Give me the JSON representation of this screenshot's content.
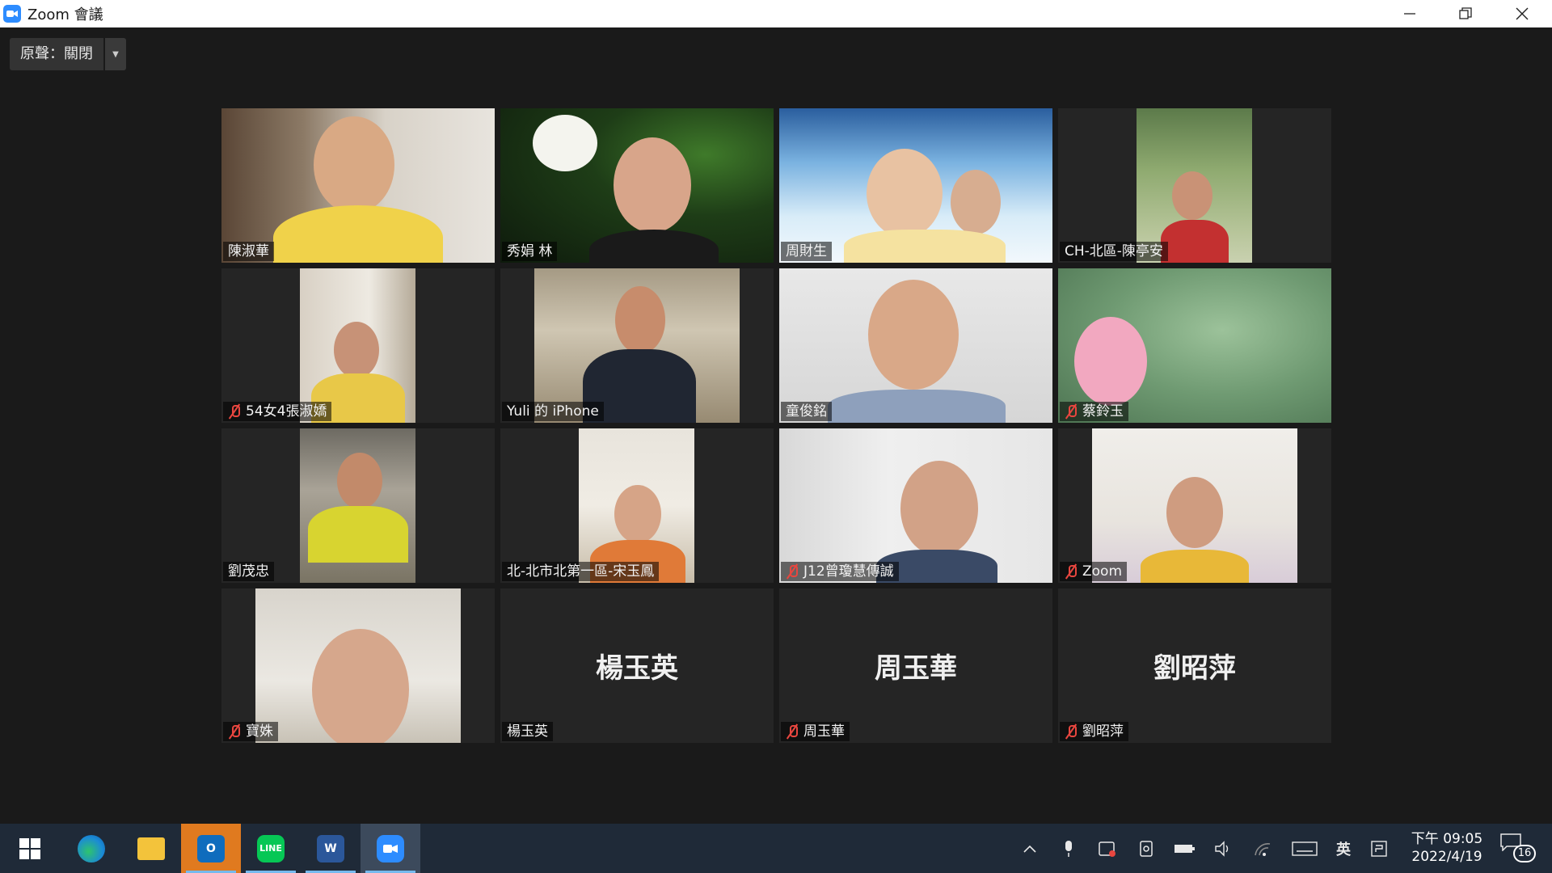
{
  "window": {
    "title": "Zoom 會議"
  },
  "toolbar": {
    "original_sound": "原聲：關閉"
  },
  "participants": [
    {
      "name": "陳淑華",
      "muted": false
    },
    {
      "name": "秀娟 林",
      "muted": false,
      "active_speaker": true
    },
    {
      "name": "周財生",
      "muted": false
    },
    {
      "name": "CH-北區-陳亭安",
      "muted": false
    },
    {
      "name": "54女4張淑嬌",
      "muted": true
    },
    {
      "name": "Yuli 的 iPhone",
      "muted": false
    },
    {
      "name": "童俊銘",
      "muted": false
    },
    {
      "name": "蔡鈴玉",
      "muted": true
    },
    {
      "name": "劉茂忠",
      "muted": false
    },
    {
      "name": "北-北市北第一區-宋玉鳳",
      "muted": false
    },
    {
      "name": "J12曾瓊慧傳誠",
      "muted": true
    },
    {
      "name": "Zoom",
      "muted": true
    },
    {
      "name": "寶姝",
      "muted": true
    },
    {
      "name": "楊玉英",
      "muted": false,
      "video_off": true
    },
    {
      "name": "周玉華",
      "muted": true,
      "video_off": true
    },
    {
      "name": "劉昭萍",
      "muted": true,
      "video_off": true
    }
  ],
  "taskbar": {
    "apps": [
      "start",
      "edge",
      "file-explorer",
      "outlook",
      "line",
      "word",
      "zoom"
    ],
    "ime": "英",
    "clock_time": "下午 09:05",
    "clock_date": "2022/4/19",
    "notification_count": "16"
  }
}
